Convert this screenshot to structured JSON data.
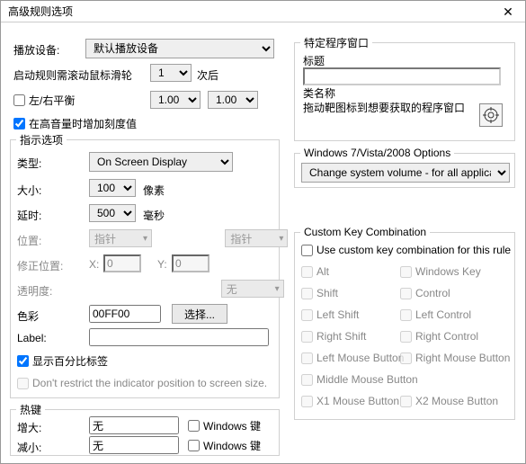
{
  "window": {
    "title": "高级规则选项"
  },
  "playback": {
    "label": "播放设备:",
    "device": "默认播放设备",
    "scroll_prefix": "启动规则需滚动鼠标滑轮",
    "scroll_count": "1",
    "scroll_suffix": "次后",
    "lr_balance": "左/右平衡",
    "lr_val1": "1.00",
    "lr_val2": "1.00",
    "add_scale": "在高音量时增加刻度值"
  },
  "indicator": {
    "legend": "指示选项",
    "type_lbl": "类型:",
    "type_val": "On Screen Display",
    "size_lbl": "大小:",
    "size_val": "100",
    "size_unit": "像素",
    "delay_lbl": "延时:",
    "delay_val": "500",
    "delay_unit": "毫秒",
    "pos_lbl": "位置:",
    "pos_val1": "指针",
    "pos_val2": "指针",
    "offset_lbl": "修正位置:",
    "x_lbl": "X:",
    "x_val": "0",
    "y_lbl": "Y:",
    "y_val": "0",
    "trans_lbl": "透明度:",
    "trans_val": "无",
    "color_lbl": "色彩",
    "color_val": "00FF00",
    "color_btn": "选择...",
    "label_lbl": "Label:",
    "label_val": "",
    "percent": "显示百分比标签",
    "restrict": "Don't restrict the indicator position to screen size."
  },
  "hotkeys": {
    "legend": "热键",
    "inc": "增大:",
    "dec": "减小:",
    "none": "无",
    "winkey": "Windows 键"
  },
  "targetwin": {
    "legend": "特定程序窗口",
    "title_lbl": "标题",
    "class_lbl": "类名称",
    "drag_hint": "拖动靶图标到想要获取的程序窗口"
  },
  "win7": {
    "legend": "Windows 7/Vista/2008 Options",
    "combo": "Change system volume - for all applications"
  },
  "keys": {
    "legend": "Custom Key Combination",
    "use": "Use custom key combination for this rule",
    "alt": "Alt",
    "win": "Windows Key",
    "shift": "Shift",
    "ctrl": "Control",
    "lshift": "Left Shift",
    "lctrl": "Left Control",
    "rshift": "Right Shift",
    "rctrl": "Right Control",
    "lmb": "Left Mouse Button",
    "rmb": "Right Mouse Button",
    "mmb": "Middle Mouse Button",
    "x1": "X1 Mouse Button",
    "x2": "X2 Mouse Button"
  }
}
